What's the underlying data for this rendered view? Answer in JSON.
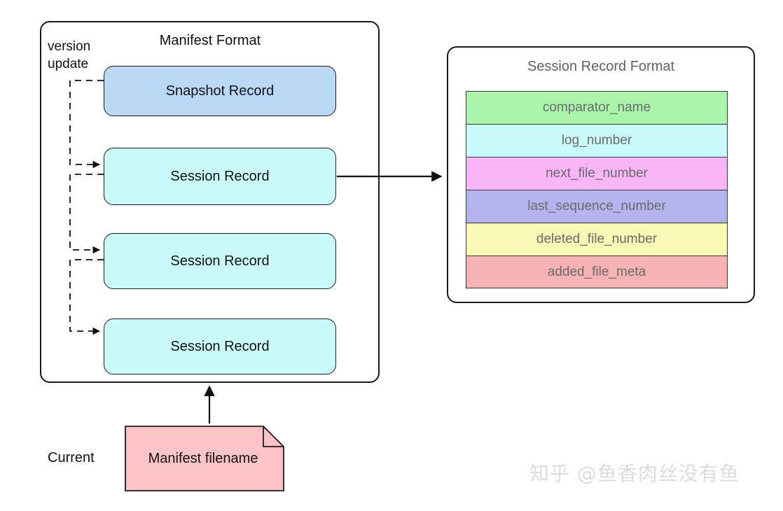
{
  "diagram": {
    "title": "Manifest Format and Session Record Format",
    "background_color": "#ffffff"
  },
  "manifest_panel": {
    "title": "Manifest Format",
    "version_update_label": "version\nupdate",
    "records": [
      {
        "label": "Snapshot Record",
        "color": "#b9d9f7",
        "kind": "snapshot"
      },
      {
        "label": "Session Record",
        "color": "#c9fbfb",
        "kind": "session"
      },
      {
        "label": "Session Record",
        "color": "#c9fbfb",
        "kind": "session"
      },
      {
        "label": "Session Record",
        "color": "#c9fbfb",
        "kind": "session"
      }
    ]
  },
  "session_panel": {
    "title": "Session Record Format",
    "fields": [
      {
        "label": "comparator_name",
        "color": "#aaf5ab"
      },
      {
        "label": "log_number",
        "color": "#c9fbfb"
      },
      {
        "label": "next_file_number",
        "color": "#f9b6f7"
      },
      {
        "label": "last_sequence_number",
        "color": "#b3b3ee"
      },
      {
        "label": "deleted_file_number",
        "color": "#f9f9b5"
      },
      {
        "label": "added_file_meta",
        "color": "#f7b3b3"
      }
    ]
  },
  "current_pointer": {
    "label": "Current",
    "file_label": "Manifest filename",
    "file_color": "#fac3c6"
  },
  "watermark": {
    "text": "知乎 @鱼香肉丝没有鱼"
  },
  "connectors": {
    "session_to_format_arrow": "Session Record -> Session Record Format",
    "current_to_manifest_arrow": "Manifest filename -> Manifest Format",
    "version_update_arrows": "dashed chain linking each record to the next"
  },
  "colors": {
    "stroke": "#1a1a1a",
    "title_dark": "#111111",
    "title_gray": "#636363",
    "field_text": "#6b6b6b",
    "watermark": "#dcdcdc"
  }
}
